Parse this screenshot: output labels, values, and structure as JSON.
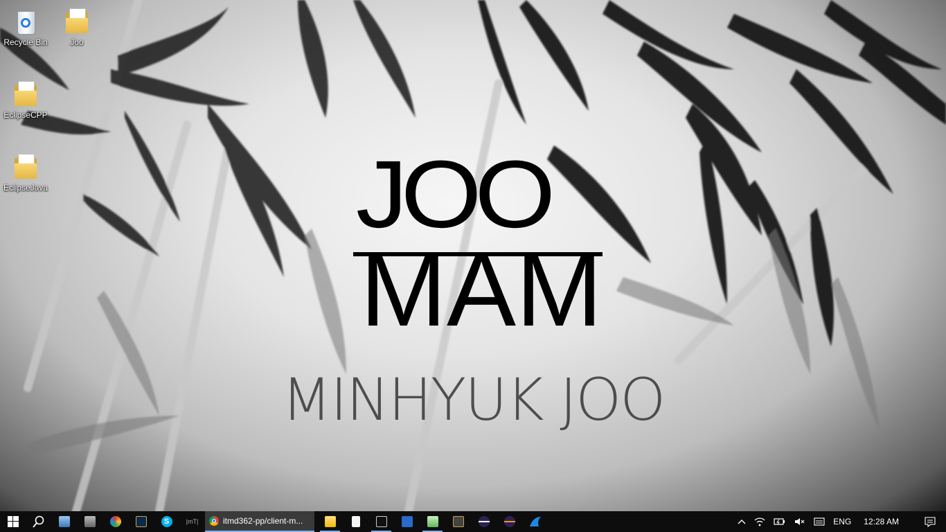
{
  "desktop": {
    "icons": [
      {
        "label": "Recycle Bin",
        "icon": "recycle-bin-icon"
      },
      {
        "label": "Joo",
        "icon": "folder-icon"
      },
      {
        "label": "EclipseCPP",
        "icon": "folder-icon"
      },
      {
        "label": "EclipseJava",
        "icon": "folder-icon"
      }
    ]
  },
  "wallpaper": {
    "logo_top": "JOO",
    "logo_bottom": "MAM",
    "wordmark": "MINHYUK JOO"
  },
  "taskbar": {
    "start_icon": "windows-start-icon",
    "search_icon": "search-icon",
    "pinned": [
      {
        "icon": "network-computer-icon"
      },
      {
        "icon": "castle-app-icon"
      },
      {
        "icon": "swirl-app-icon"
      },
      {
        "icon": "league-launcher-icon"
      },
      {
        "icon": "skype-icon"
      },
      {
        "label": "|mT|",
        "icon": "mt-app-icon"
      }
    ],
    "active_task": {
      "label": "itmd362-pp/client-m...",
      "icon": "chrome-icon"
    },
    "apps": [
      {
        "icon": "file-explorer-icon"
      },
      {
        "icon": "document-icon"
      },
      {
        "icon": "command-prompt-icon"
      },
      {
        "icon": "powershell-icon"
      },
      {
        "icon": "notepad-icon"
      },
      {
        "icon": "media-app-icon"
      },
      {
        "icon": "eclipse-cpp-icon"
      },
      {
        "icon": "eclipse-java-icon"
      },
      {
        "icon": "shark-app-icon"
      }
    ],
    "tray": {
      "language": "ENG",
      "time": "12:28 AM"
    }
  },
  "colors": {
    "taskbar_bg": "#0d0d0d",
    "active_underline": "#7ab4ff"
  }
}
